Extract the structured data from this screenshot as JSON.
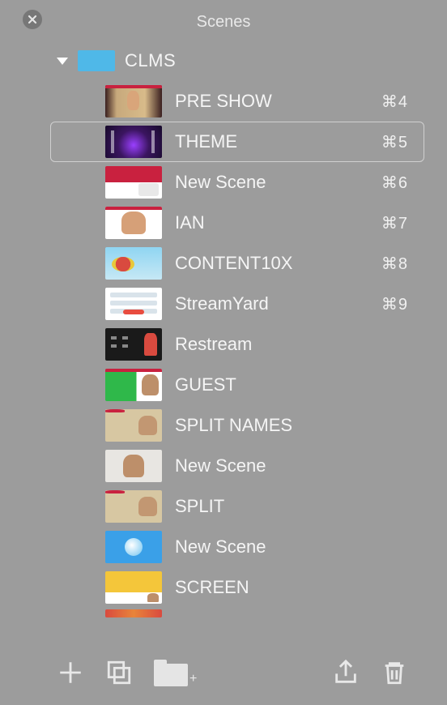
{
  "title": "Scenes",
  "group": {
    "label": "CLMS"
  },
  "scenes": [
    {
      "label": "PRE SHOW",
      "shortcut": "⌘4",
      "thumb": "th-preshow redbar",
      "selected": false
    },
    {
      "label": "THEME",
      "shortcut": "⌘5",
      "thumb": "th-theme",
      "selected": true
    },
    {
      "label": "New Scene",
      "shortcut": "⌘6",
      "thumb": "th-newscene1",
      "selected": false
    },
    {
      "label": "IAN",
      "shortcut": "⌘7",
      "thumb": "th-ian",
      "selected": false
    },
    {
      "label": "CONTENT10X",
      "shortcut": "⌘8",
      "thumb": "th-content10x",
      "selected": false
    },
    {
      "label": "StreamYard",
      "shortcut": "⌘9",
      "thumb": "th-streamyard",
      "selected": false
    },
    {
      "label": "Restream",
      "shortcut": "",
      "thumb": "th-restream",
      "selected": false
    },
    {
      "label": "GUEST",
      "shortcut": "",
      "thumb": "th-guest",
      "selected": false
    },
    {
      "label": "SPLIT NAMES",
      "shortcut": "",
      "thumb": "th-splitnames redbar",
      "selected": false
    },
    {
      "label": "New Scene",
      "shortcut": "",
      "thumb": "th-newscene2",
      "selected": false
    },
    {
      "label": "SPLIT",
      "shortcut": "",
      "thumb": "th-split redbar",
      "selected": false
    },
    {
      "label": "New Scene",
      "shortcut": "",
      "thumb": "th-newscene3",
      "selected": false
    },
    {
      "label": "SCREEN",
      "shortcut": "",
      "thumb": "th-screen",
      "selected": false
    }
  ],
  "toolbar": {
    "add": "add",
    "dup": "duplicate",
    "folder": "new-folder",
    "share": "share",
    "trash": "delete"
  }
}
